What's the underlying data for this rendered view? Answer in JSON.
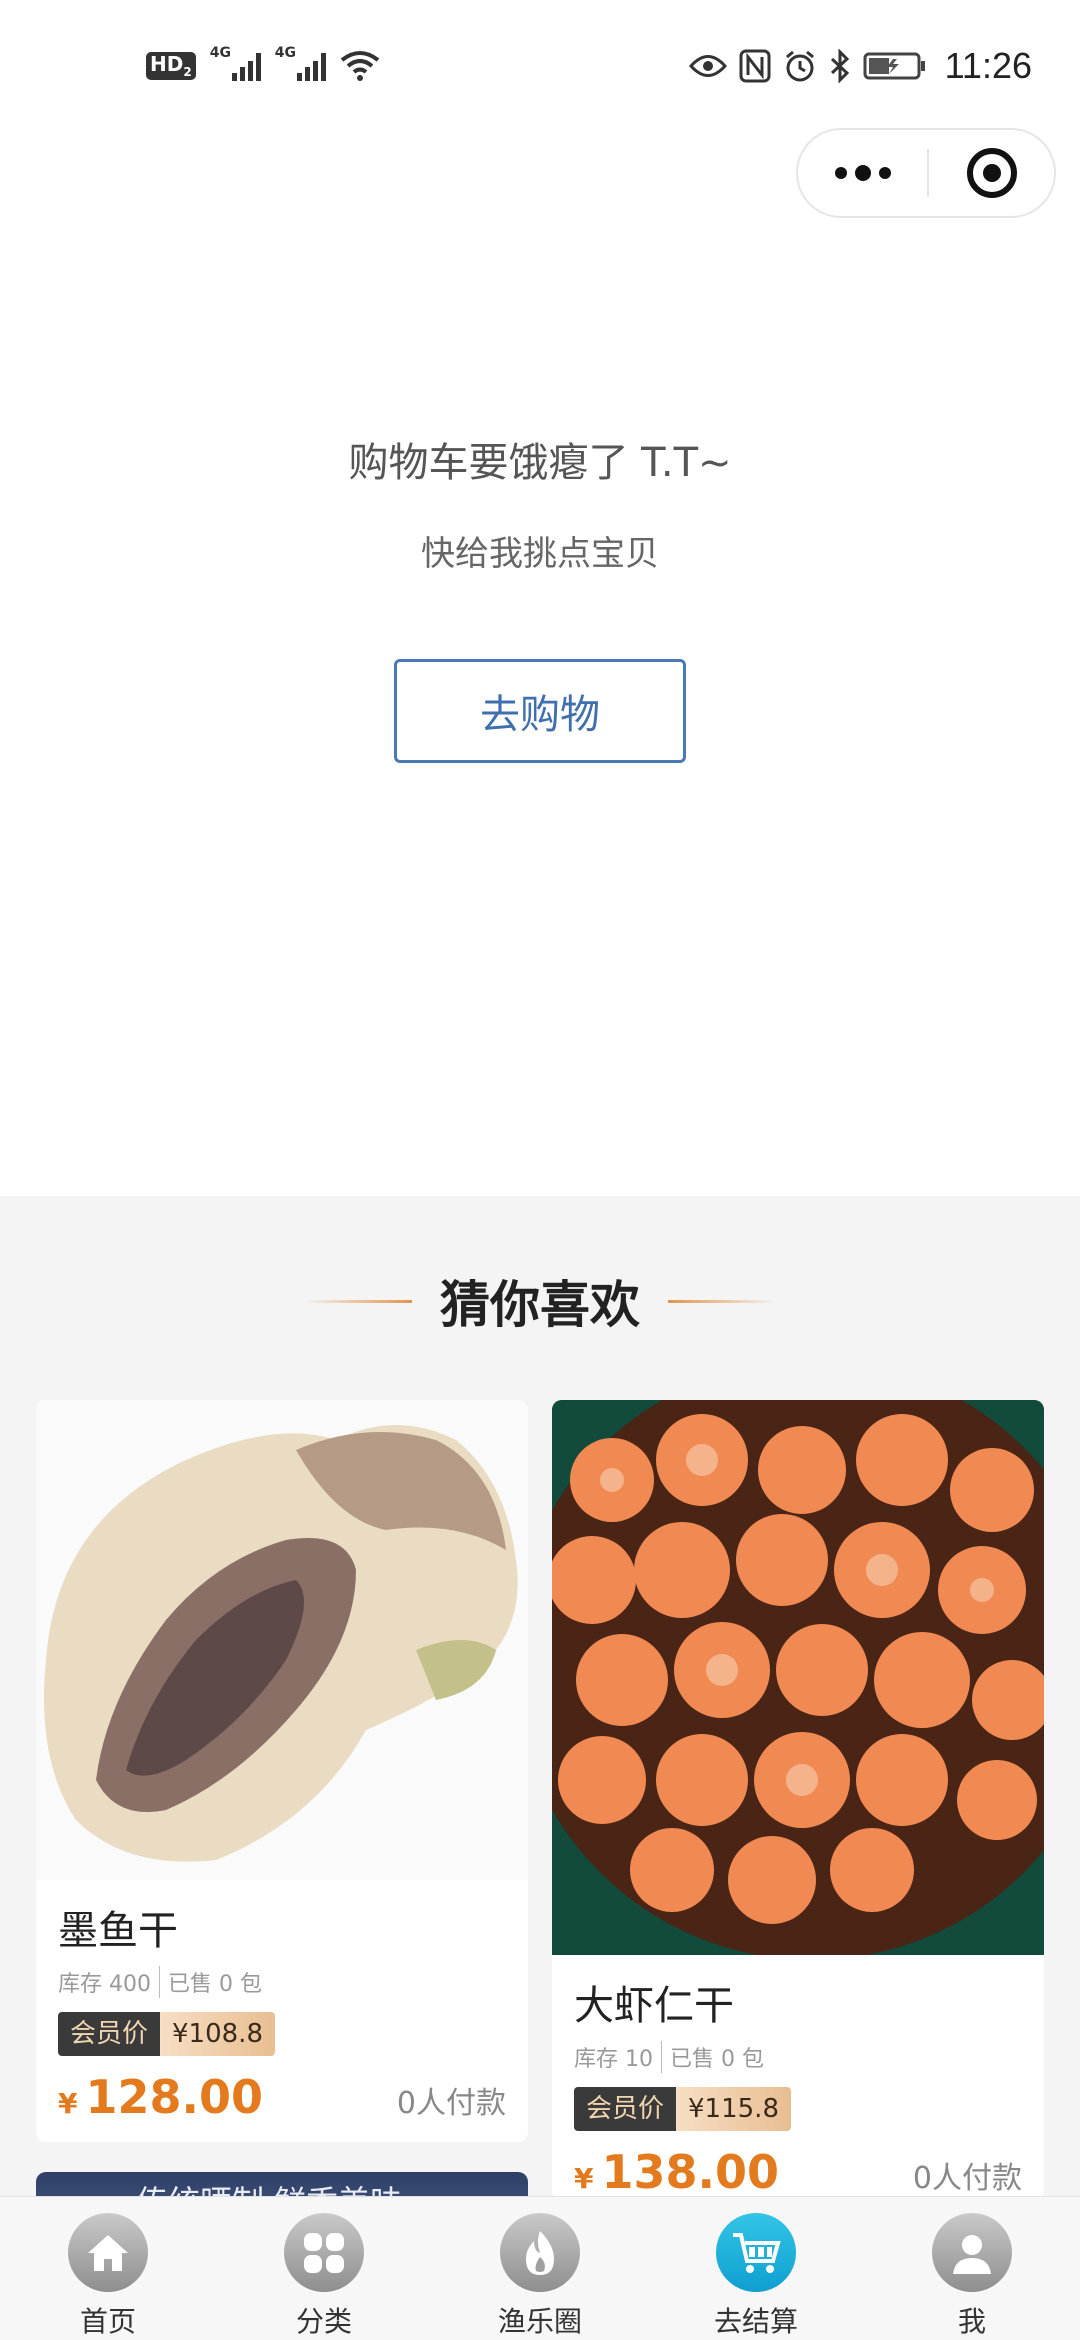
{
  "status_bar": {
    "hd": "HD",
    "hd_sub": "2",
    "signal1": "4G",
    "signal2": "4G",
    "time": "11:26"
  },
  "cart": {
    "empty_title": "购物车要饿瘪了 T.T~",
    "empty_subtitle": "快给我挑点宝贝",
    "go_shopping": "去购物"
  },
  "recommend": {
    "title": "猜你喜欢",
    "products": [
      {
        "name": "墨鱼干",
        "stock": "库存 400",
        "sold": "已售 0 包",
        "member_label": "会员价",
        "member_price": "¥108.8",
        "currency": "¥",
        "price": "128.00",
        "paid": "0人付款",
        "image_icon": "dried-cuttlefish-photo"
      },
      {
        "name": "大虾仁干",
        "stock": "库存 10",
        "sold": "已售 0 包",
        "member_label": "会员价",
        "member_price": "¥115.8",
        "currency": "¥",
        "price": "138.00",
        "paid": "0人付款",
        "image_icon": "dried-shrimp-photo"
      },
      {
        "banner_text": "传统晒制 鲜香美味",
        "image_icon": "product-banner-photo"
      }
    ]
  },
  "tabbar": {
    "tabs": [
      {
        "label": "首页",
        "icon": "home-icon"
      },
      {
        "label": "分类",
        "icon": "category-icon"
      },
      {
        "label": "渔乐圈",
        "icon": "flame-icon"
      },
      {
        "label": "去结算",
        "icon": "cart-icon"
      },
      {
        "label": "我",
        "icon": "user-icon"
      }
    ],
    "active_index": 3,
    "active_color": "#1aa9d8",
    "inactive_color": "#a8a8a8"
  },
  "colors": {
    "price": "#e37a1e",
    "button_border": "#4a79b5",
    "section_bg": "#f4f4f4"
  }
}
